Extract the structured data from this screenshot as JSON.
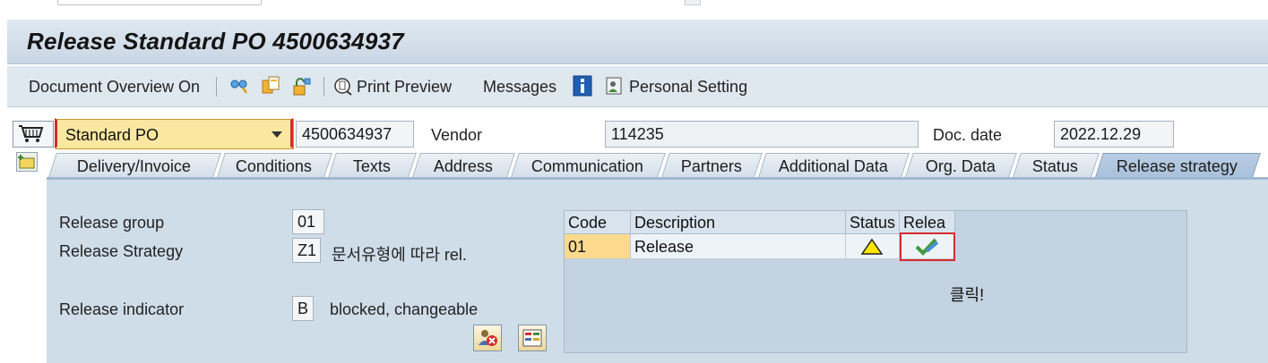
{
  "window": {
    "title": "Release Standard PO 4500634937"
  },
  "toolbar": {
    "doc_overview": "Document Overview On",
    "print_preview": "Print Preview",
    "messages": "Messages",
    "personal_setting": "Personal Setting",
    "icons": [
      "glasses-icon",
      "copy-doc-icon",
      "lock-icon",
      "print-preview-icon",
      "info-icon",
      "personal-setting-icon"
    ]
  },
  "header": {
    "doc_type": "Standard PO",
    "po_number": "4500634937",
    "vendor_label": "Vendor",
    "vendor_value": "114235",
    "doc_date_label": "Doc. date",
    "doc_date_value": "2022.12.29"
  },
  "tabs": [
    "Delivery/Invoice",
    "Conditions",
    "Texts",
    "Address",
    "Communication",
    "Partners",
    "Additional Data",
    "Org. Data",
    "Status",
    "Release strategy"
  ],
  "active_tab": "Release strategy",
  "release": {
    "group_label": "Release group",
    "group_value": "01",
    "strategy_label": "Release Strategy",
    "strategy_value": "Z1",
    "strategy_desc": "문서유형에 따라 rel.",
    "indicator_label": "Release indicator",
    "indicator_value": "B",
    "indicator_desc": "blocked, changeable"
  },
  "grid": {
    "headers": [
      "Code",
      "Description",
      "Status",
      "Relea"
    ],
    "rows": [
      {
        "code": "01",
        "description": "Release",
        "status_icon": "warning-icon",
        "release_icon": "release-check-icon"
      }
    ]
  },
  "annotation": "클릭!",
  "colors": {
    "accent_highlight": "#d42b2b",
    "field_yellow": "#fbe7a0",
    "panel_bg": "#cfdde9",
    "active_tab": "#a8c0db"
  }
}
